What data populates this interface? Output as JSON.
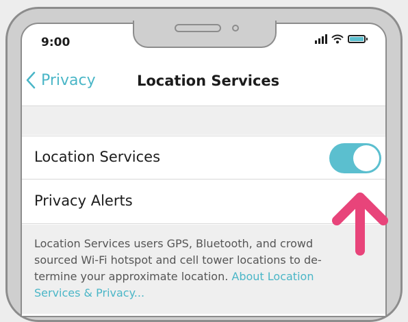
{
  "status_bar": {
    "time": "9:00"
  },
  "nav": {
    "back_label": "Privacy",
    "title": "Location Services"
  },
  "rows": [
    {
      "label": "Location Services",
      "toggle_on": true
    },
    {
      "label": "Privacy Alerts"
    }
  ],
  "footer": {
    "text": "Location Services users GPS, Bluetooth, and crowd sourced Wi-Fi hotspot and cell tower locations to de-termine your approximate location. ",
    "link": "About Location Services & Privacy..."
  },
  "colors": {
    "accent": "#5bbfcf",
    "link": "#4ab6c7",
    "arrow": "#e8447a",
    "frame": "#cfcfcf"
  },
  "icons": [
    "signal-icon",
    "wifi-icon",
    "battery-icon",
    "chevron-left-icon",
    "arrow-up-icon"
  ]
}
